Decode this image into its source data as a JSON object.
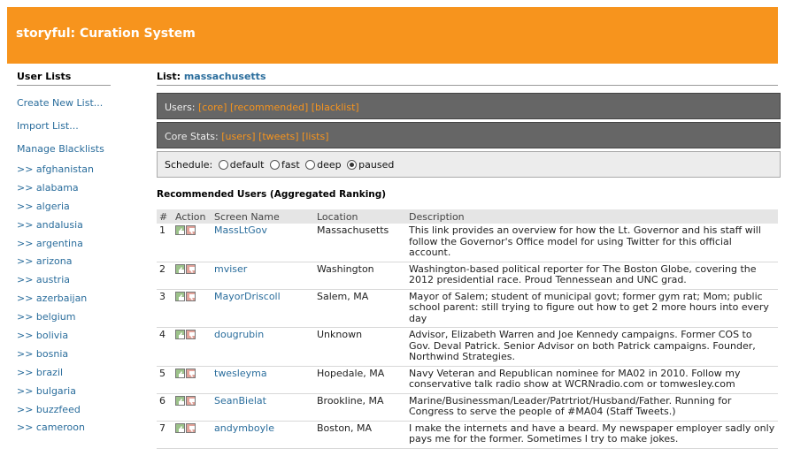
{
  "header": {
    "title": "storyful: Curation System",
    "color": "#f7941d"
  },
  "sidebar": {
    "heading": "User Lists",
    "actions": [
      "Create New List...",
      "Import List...",
      "Manage Blacklists"
    ],
    "lists": [
      ">> afghanistan",
      ">> alabama",
      ">> algeria",
      ">> andalusia",
      ">> argentina",
      ">> arizona",
      ">> austria",
      ">> azerbaijan",
      ">> belgium",
      ">> bolivia",
      ">> bosnia",
      ">> brazil",
      ">> bulgaria",
      ">> buzzfeed",
      ">> cameroon"
    ]
  },
  "main": {
    "list_label": "List:",
    "list_name": "massachusetts",
    "users_bar": {
      "label": "Users:",
      "links": [
        "[core]",
        "[recommended]",
        "[blacklist]"
      ]
    },
    "stats_bar": {
      "label": "Core Stats:",
      "links": [
        "[users]",
        "[tweets]",
        "[lists]"
      ]
    },
    "schedule": {
      "label": "Schedule:",
      "options": [
        "default",
        "fast",
        "deep",
        "paused"
      ],
      "selected": "paused"
    },
    "recommended_heading": "Recommended Users (Aggregated Ranking)",
    "table": {
      "columns": [
        "#",
        "Action",
        "Screen Name",
        "Location",
        "Description"
      ],
      "rows": [
        {
          "rank": "1",
          "screen_name": "MassLtGov",
          "location": "Massachusetts",
          "description": "This link provides an overview for how the Lt. Governor and his staff will follow the Governor's Office model for using Twitter for this official account."
        },
        {
          "rank": "2",
          "screen_name": "mviser",
          "location": "Washington",
          "description": "Washington-based political reporter for The Boston Globe, covering the 2012 presidential race. Proud Tennessean and UNC grad."
        },
        {
          "rank": "3",
          "screen_name": "MayorDriscoll",
          "location": "Salem, MA",
          "description": "Mayor of Salem; student of municipal govt; former gym rat; Mom; public school parent: still trying to figure out how to get 2 more hours into every day"
        },
        {
          "rank": "4",
          "screen_name": "dougrubin",
          "location": "Unknown",
          "description": "Advisor, Elizabeth Warren and Joe Kennedy campaigns. Former COS to Gov. Deval Patrick. Senior Advisor on both Patrick campaigns. Founder, Northwind Strategies."
        },
        {
          "rank": "5",
          "screen_name": "twesleyma",
          "location": "Hopedale, MA",
          "description": "Navy Veteran and Republican nominee for MA02 in 2010. Follow my conservative talk radio show at WCRNradio.com or tomwesley.com"
        },
        {
          "rank": "6",
          "screen_name": "SeanBielat",
          "location": "Brookline, MA",
          "description": "Marine/Businessman/Leader/Patrtriot/Husband/Father. Running for Congress to serve the people of #MA04 (Staff Tweets.)"
        },
        {
          "rank": "7",
          "screen_name": "andymboyle",
          "location": "Boston, MA",
          "description": "I make the internets and have a beard. My newspaper employer sadly only pays me for the former. Sometimes I try to make jokes."
        }
      ]
    }
  },
  "icons": {
    "approve": "thumbs-up-icon",
    "reject": "thumbs-down-icon"
  }
}
